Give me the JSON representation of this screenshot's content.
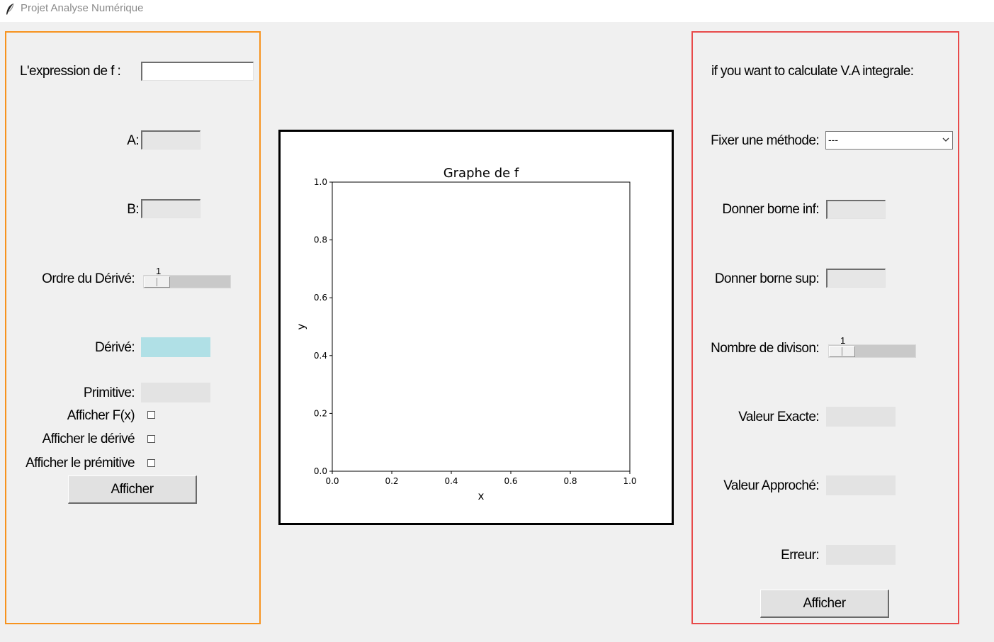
{
  "window": {
    "title": "Projet Analyse Numérique",
    "icon": "feather-icon"
  },
  "left": {
    "expression_label": "L'expression de f :",
    "expression_value": "",
    "a_label": "A:",
    "a_value": "",
    "b_label": "B:",
    "b_value": "",
    "order_label": "Ordre du Dérivé:",
    "order_value": "1",
    "derive_label": "Dérivé:",
    "primitive_label": "Primitive:",
    "show_fx_label": "Afficher F(x)",
    "show_derive_label": "Afficher le dérivé",
    "show_primitive_label": "Afficher le prémitive",
    "button_label": "Afficher"
  },
  "right": {
    "intro_label": "if you want to calculate V.A integrale:",
    "method_label": "Fixer une méthode:",
    "method_selected": "---",
    "borne_inf_label": "Donner borne inf:",
    "borne_sup_label": "Donner borne sup:",
    "divisions_label": "Nombre de divison:",
    "divisions_value": "1",
    "exact_label": "Valeur Exacte:",
    "approx_label": "Valeur Approché:",
    "error_label": "Erreur:",
    "button_label": "Afficher"
  },
  "colors": {
    "left_border": "#f7931e",
    "right_border": "#e84a4a",
    "derive_field": "#b0e0e6"
  },
  "chart_data": {
    "type": "line",
    "title": "Graphe de f",
    "xlabel": "x",
    "ylabel": "y",
    "xlim": [
      0,
      1
    ],
    "ylim": [
      0,
      1
    ],
    "xticks": [
      "0.0",
      "0.2",
      "0.4",
      "0.6",
      "0.8",
      "1.0"
    ],
    "yticks": [
      "0.0",
      "0.2",
      "0.4",
      "0.6",
      "0.8",
      "1.0"
    ],
    "series": [],
    "grid": false
  }
}
